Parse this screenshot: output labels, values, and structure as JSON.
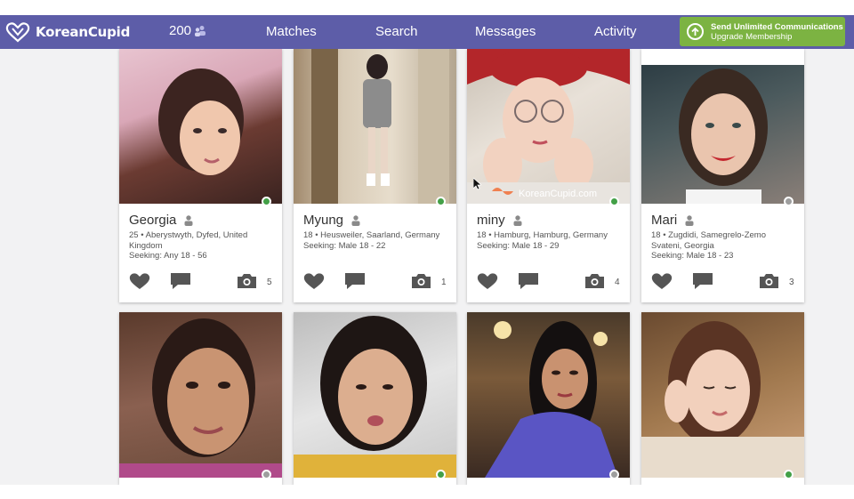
{
  "brand": {
    "name": "KoreanCupid"
  },
  "header": {
    "credits": "200",
    "nav": [
      "Matches",
      "Search",
      "Messages",
      "Activity"
    ],
    "upgrade": {
      "title": "Send Unlimited Communications",
      "subtitle": "Upgrade Membership"
    }
  },
  "colors": {
    "navbar": "#5d5da8",
    "upgrade": "#7cb342",
    "online": "#43a047",
    "offline": "#9e9e9e"
  },
  "profiles": [
    {
      "name": "Georgia",
      "details": "25 • Aberystwyth, Dyfed, United Kingdom",
      "seeking": "Seeking: Any 18 - 56",
      "photos": "5",
      "online": true
    },
    {
      "name": "Myung",
      "details": "18 • Heusweiler, Saarland, Germany",
      "seeking": "Seeking: Male 18 - 22",
      "photos": "1",
      "online": true
    },
    {
      "name": "miny",
      "details": "18 • Hamburg, Hamburg, Germany",
      "seeking": "Seeking: Male 18 - 29",
      "photos": "4",
      "online": true
    },
    {
      "name": "Mari",
      "details": "18 • Zugdidi, Samegrelo-Zemo Svateni, Georgia",
      "seeking": "Seeking: Male 18 - 23",
      "photos": "3",
      "online": false
    },
    {
      "online": false
    },
    {
      "online": true
    },
    {
      "online": false
    },
    {
      "online": true
    }
  ],
  "watermark": "KoreanCupid.com"
}
